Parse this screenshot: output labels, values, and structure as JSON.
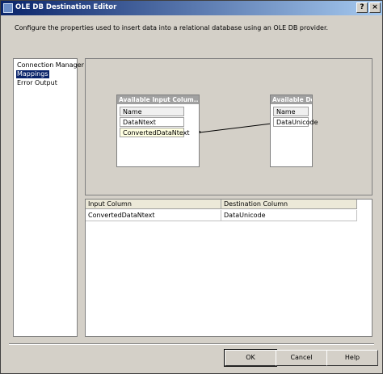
{
  "window": {
    "title": "OLE DB Destination Editor",
    "help_glyph": "?",
    "close_glyph": "×"
  },
  "description": "Configure the properties used to insert data into a relational database using an OLE DB provider.",
  "nav": {
    "items": [
      {
        "label": "Connection Manager",
        "selected": false
      },
      {
        "label": "Mappings",
        "selected": true
      },
      {
        "label": "Error Output",
        "selected": false
      }
    ]
  },
  "designer": {
    "input_box": {
      "title": "Available Input Colum...",
      "header": "Name",
      "rows": [
        "DataNtext",
        "ConvertedDataNtext"
      ]
    },
    "dest_box": {
      "title": "Available Destin...",
      "header": "Name",
      "rows": [
        "DataUnicode"
      ]
    },
    "mapping": {
      "from": "ConvertedDataNtext",
      "to": "DataUnicode"
    }
  },
  "grid": {
    "columns": [
      "Input Column",
      "Destination Column"
    ],
    "rows": [
      [
        "ConvertedDataNtext",
        "DataUnicode"
      ]
    ]
  },
  "buttons": {
    "ok": "OK",
    "cancel": "Cancel",
    "help": "Help"
  },
  "colors": {
    "titlebar_start": "#0a246a",
    "titlebar_end": "#a6caf0",
    "selection": "#0a246a",
    "face": "#d4d0c8"
  }
}
